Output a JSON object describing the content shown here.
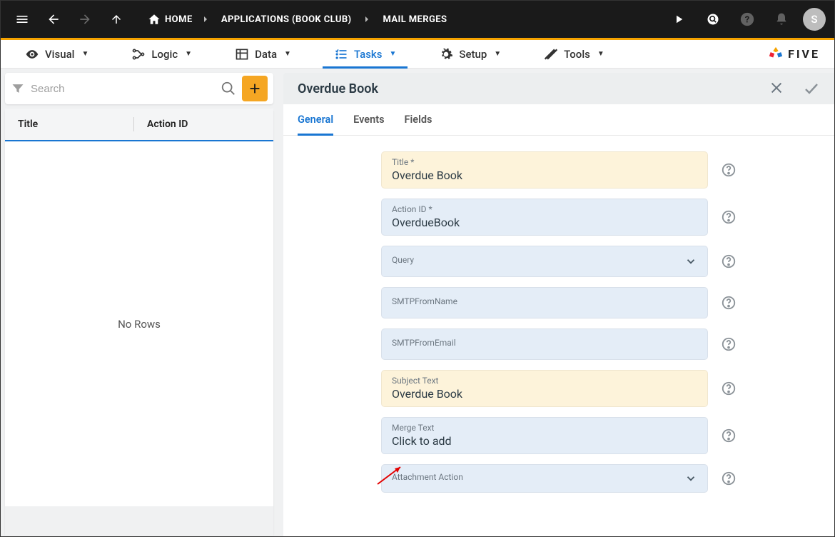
{
  "topbar": {
    "home_label": "HOME",
    "crumbs": [
      "APPLICATIONS (BOOK CLUB)",
      "MAIL MERGES"
    ],
    "avatar_initial": "S"
  },
  "tabs": {
    "visual": "Visual",
    "logic": "Logic",
    "data": "Data",
    "tasks": "Tasks",
    "setup": "Setup",
    "tools": "Tools"
  },
  "brand": "FIVE",
  "list": {
    "search_placeholder": "Search",
    "col_title": "Title",
    "col_action_id": "Action ID",
    "empty": "No Rows"
  },
  "detail": {
    "title": "Overdue Book",
    "subtabs": {
      "general": "General",
      "events": "Events",
      "fields": "Fields"
    },
    "fields": {
      "title": {
        "label": "Title *",
        "value": "Overdue Book"
      },
      "action_id": {
        "label": "Action ID *",
        "value": "OverdueBook"
      },
      "query": {
        "label": "Query",
        "value": ""
      },
      "smtp_name": {
        "label": "SMTPFromName",
        "value": ""
      },
      "smtp_email": {
        "label": "SMTPFromEmail",
        "value": ""
      },
      "subject": {
        "label": "Subject Text",
        "value": "Overdue Book"
      },
      "merge": {
        "label": "Merge Text",
        "value": "Click to add"
      },
      "attachment": {
        "label": "Attachment Action",
        "value": ""
      }
    }
  }
}
